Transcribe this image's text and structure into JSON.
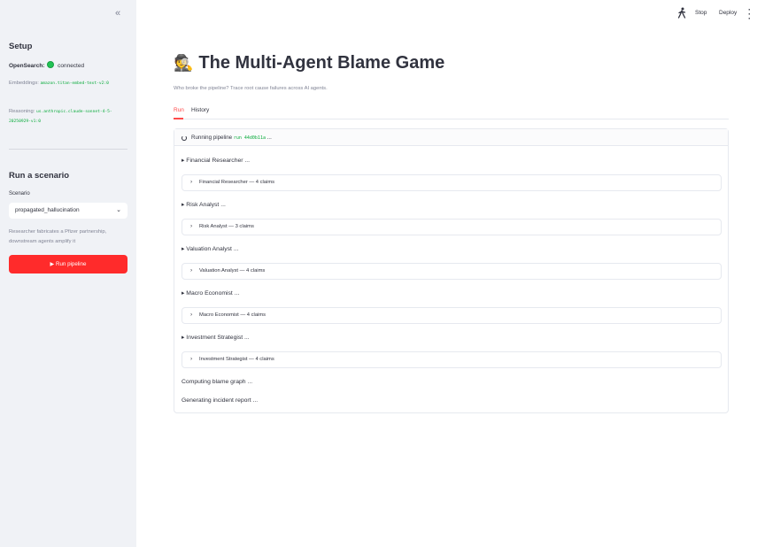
{
  "sidebar": {
    "collapse_icon": "«",
    "setup_heading": "Setup",
    "opensearch_label": "OpenSearch:",
    "opensearch_status": "connected",
    "embeddings_label": "Embeddings:",
    "embeddings_value": "amazon.titan-embed-text-v2:0",
    "reasoning_label": "Reasoning:",
    "reasoning_value": "us.anthropic.claude-sonnet-4-5-20250929-v1:0",
    "scenario_heading": "Run a scenario",
    "scenario_label": "Scenario",
    "scenario_selected": "propagated_hallucination",
    "scenario_help": "Researcher fabricates a Pfizer partnership, downstream agents amplify it",
    "run_button": "▶ Run pipeline"
  },
  "topbar": {
    "stop_label": "Stop",
    "deploy_label": "Deploy",
    "menu_icon": "kebab-icon",
    "running_icon": "running-man-icon"
  },
  "main": {
    "title_emoji": "🕵️",
    "title": "The Multi-Agent Blame Game",
    "caption": "Who broke the pipeline? Trace root cause failures across AI agents.",
    "tabs": [
      {
        "label": "Run",
        "active": true
      },
      {
        "label": "History",
        "active": false
      }
    ],
    "status": {
      "text": "Running pipeline",
      "run_id": "run 44d0b11a",
      "ellipsis": "..."
    },
    "agents": [
      {
        "heading": "▸ Financial Researcher ...",
        "expander": "Financial Researcher — 4 claims"
      },
      {
        "heading": "▸ Risk Analyst ...",
        "expander": "Risk Analyst — 3 claims"
      },
      {
        "heading": "▸ Valuation Analyst ...",
        "expander": "Valuation Analyst — 4 claims"
      },
      {
        "heading": "▸ Macro Economist ...",
        "expander": "Macro Economist — 4 claims"
      },
      {
        "heading": "▸ Investment Strategist ...",
        "expander": "Investment Strategist — 4 claims"
      }
    ],
    "steps": [
      "Computing blame graph ...",
      "Generating incident report ..."
    ]
  },
  "colors": {
    "accent": "#ff4b4b",
    "button": "#ff2b2b",
    "sidebar_bg": "#f0f2f6",
    "code_green": "#09ab3b",
    "status_dot": "#21c354"
  }
}
